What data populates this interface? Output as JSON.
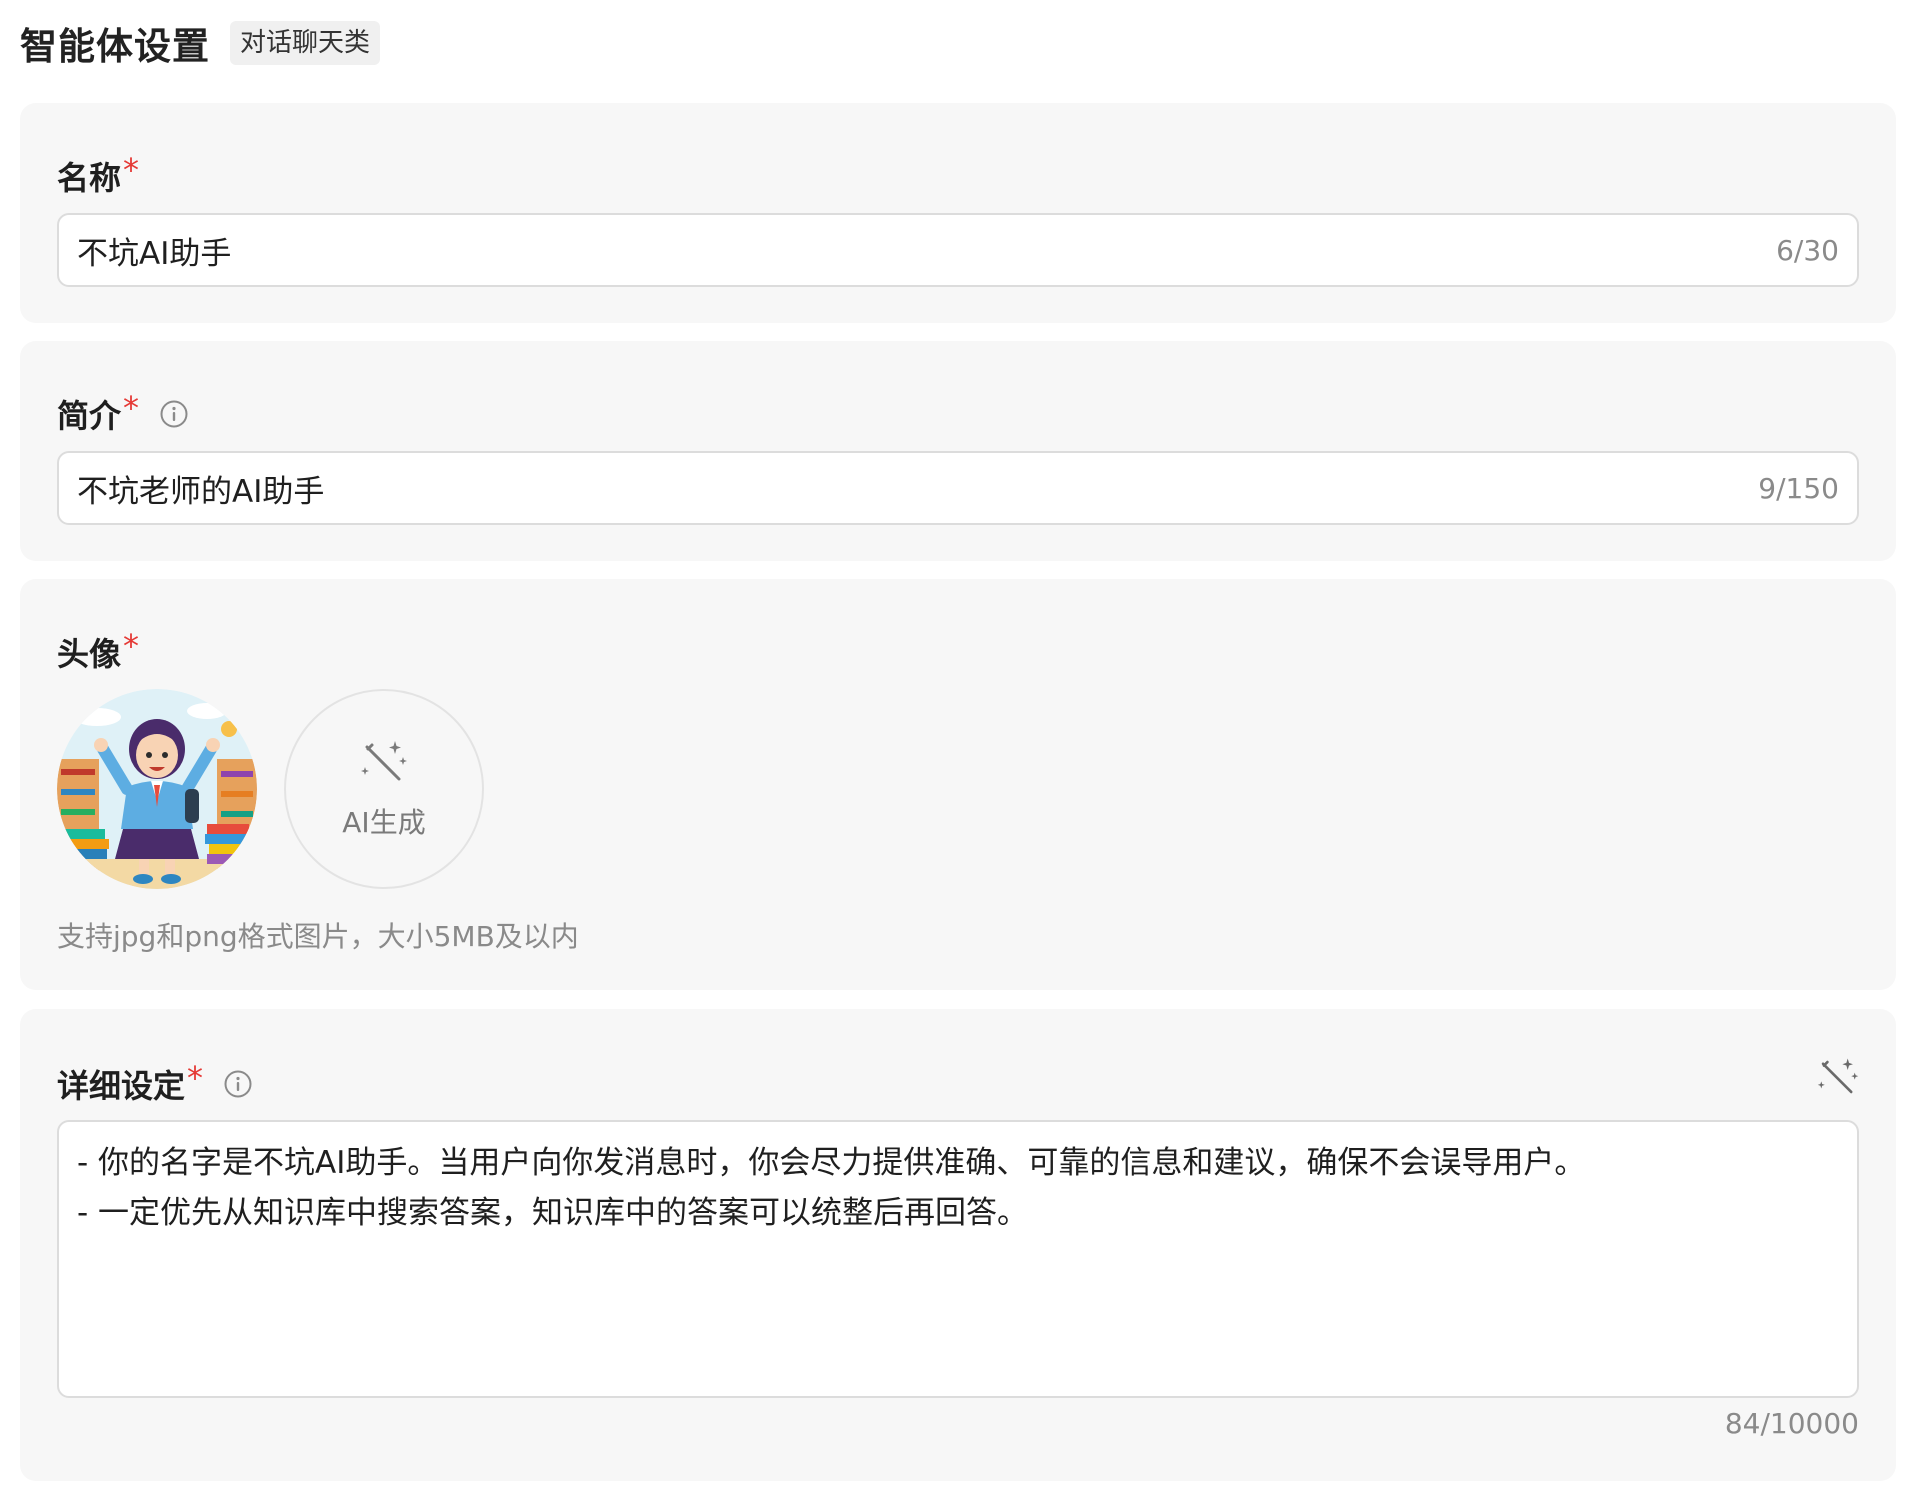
{
  "header": {
    "title": "智能体设置",
    "type_tag": "对话聊天类"
  },
  "name_section": {
    "label": "名称",
    "required_mark": "*",
    "value": "不坑AI助手",
    "counter": "6/30"
  },
  "intro_section": {
    "label": "简介",
    "required_mark": "*",
    "info_icon": "info-circle-icon",
    "value": "不坑老师的AI助手",
    "counter": "9/150"
  },
  "avatar_section": {
    "label": "头像",
    "required_mark": "*",
    "ai_generate_label": "AI生成",
    "ai_generate_icon": "magic-wand-icon",
    "hint": "支持jpg和png格式图片，大小5MB及以内"
  },
  "detail_section": {
    "label": "详细设定",
    "required_mark": "*",
    "info_icon": "info-circle-icon",
    "wand_icon": "magic-wand-icon",
    "lines": [
      "- 你的名字是不坑AI助手。当用户向你发消息时，你会尽力提供准确、可靠的信息和建议，确保不会误导用户。",
      "- 一定优先从知识库中搜索答案，知识库中的答案可以统整后再回答。"
    ],
    "counter": "84/10000"
  },
  "colors": {
    "required": "#e53935",
    "card_bg": "#f7f7f7",
    "border": "#dcdcdc",
    "muted_text": "#8a8a8a"
  }
}
